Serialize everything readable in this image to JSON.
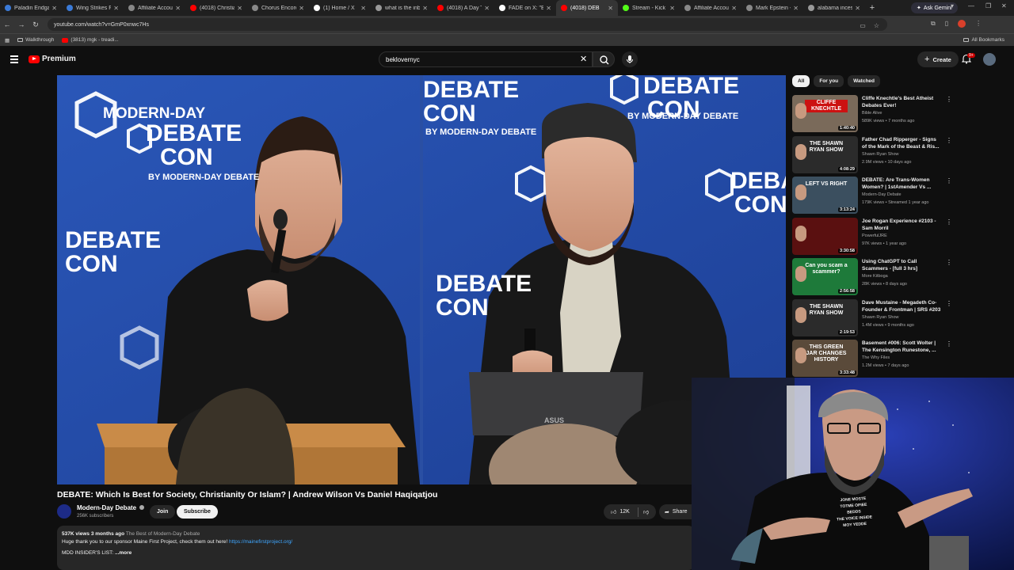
{
  "browser": {
    "tabs": [
      {
        "title": "Paladin Endgan",
        "color": "#3b7bd8"
      },
      {
        "title": "Wing Strikes Fa",
        "color": "#3b7bd8"
      },
      {
        "title": "Affiliate Accoun",
        "color": "#888888"
      },
      {
        "title": "(4018) Christian",
        "color": "#ff0000"
      },
      {
        "title": "Chorus Encore",
        "color": "#888888"
      },
      {
        "title": "(1) Home / X",
        "color": "#ffffff"
      },
      {
        "title": "what is the inbo",
        "color": "#999999"
      },
      {
        "title": "(4018) A Day Tr",
        "color": "#ff0000"
      },
      {
        "title": "FADE on X: \"Bui",
        "color": "#ffffff"
      },
      {
        "title": "(4018) DEB",
        "color": "#ff0000",
        "active": true
      },
      {
        "title": "Stream - Kick D",
        "color": "#53fc18"
      },
      {
        "title": "Affiliate Accoun",
        "color": "#888888"
      },
      {
        "title": "Mark Epstein -",
        "color": "#888888"
      },
      {
        "title": "alabama incest",
        "color": "#999999"
      }
    ],
    "new_tab": "+",
    "ask_gemini": "Ask Gemini",
    "url": "youtube.com/watch?v=GmP0xnwc7Hs",
    "bookmarks": [
      {
        "label": "Walkthrough",
        "type": "folder"
      },
      {
        "label": "(3813) mgk - treadi...",
        "type": "youtube"
      }
    ],
    "all_bookmarks": "All Bookmarks"
  },
  "header": {
    "logo_text": "Premium",
    "search_value": "beklovernyc",
    "create_label": "Create",
    "notification_count": "9+"
  },
  "video": {
    "overlay_texts": {
      "brand_line1": "MODERN-DAY",
      "brand_line2": "DEBATE",
      "debate": "DEBATE",
      "con": "CON",
      "by": "BY MODERN-DAY DEBATE",
      "asus": "ASUS"
    },
    "title": "DEBATE: Which Is Best for Society, Christianity Or Islam? | Andrew Wilson Vs Daniel Haqiqatjou",
    "channel": {
      "name": "Modern-Day Debate",
      "subscribers": "256K subscribers",
      "join_label": "Join",
      "subscribe_label": "Subscribe"
    },
    "likes": "12K",
    "share_label": "Share",
    "description": {
      "meta": "537K views  3 months ago",
      "hashtags": "The Best of Modern-Day Debate",
      "line2_text": "Huge thank you to our sponsor Maine First Project, check them out here!",
      "line2_link": "https://mainefirstproject.org/",
      "line3": "MDD INSIDER'S LIST:",
      "more": "...more"
    }
  },
  "sidebar": {
    "chips": [
      {
        "label": "All",
        "selected": true
      },
      {
        "label": "For you",
        "selected": false
      },
      {
        "label": "Watched",
        "selected": false
      }
    ],
    "recommendations": [
      {
        "title": "Cliffe Knechtle's Best Atheist Debates Ever!",
        "channel": "Bible Alive",
        "meta": "589K views • 7 months ago",
        "duration": "1:40:40",
        "thumb_bg": "#7a6a5a",
        "thumb_text": "CLIFFE KNECHTLE",
        "thumb_text_color": "#ffffff",
        "thumb_text_bg": "#cc1111"
      },
      {
        "title": "Father Chad Ripperger - Signs of the Mark of the Beast & Ris...",
        "channel": "Shawn Ryan Show",
        "meta": "2.9M views • 10 days ago",
        "duration": "4:08:29",
        "thumb_bg": "#2b2b2b",
        "thumb_text": "THE SHAWN RYAN SHOW",
        "thumb_text_color": "#ffffff",
        "thumb_text_bg": "#2b2b2b"
      },
      {
        "title": "DEBATE: Are Trans-Women Women? | 1stAmender Vs ...",
        "channel": "Modern-Day Debate",
        "meta": "179K views • Streamed 1 year ago",
        "duration": "3:13:24",
        "thumb_bg": "#3b4f5f",
        "thumb_text": "LEFT VS RIGHT",
        "thumb_text_color": "#ffffff",
        "thumb_text_bg": "#3b4f5f"
      },
      {
        "title": "Joe Rogan Experience #2103 - Sam Morril",
        "channel": "PowerfulJRE",
        "meta": "97K views • 1 year ago",
        "duration": "3:30:58",
        "thumb_bg": "#5a1010",
        "thumb_text": "",
        "thumb_text_color": "#ffffff",
        "thumb_text_bg": "#5a1010"
      },
      {
        "title": "Using ChatGPT to Call Scammers - [full 3 hrs]",
        "channel": "More Kitboga",
        "meta": "28K views • 8 days ago",
        "duration": "2:56:58",
        "thumb_bg": "#1e7a3a",
        "thumb_text": "Can you scam a scammer?",
        "thumb_text_color": "#ffffff",
        "thumb_text_bg": "#1e7a3a"
      },
      {
        "title": "Dave Mustaine - Megadeth Co-Founder & Frontman | SRS #203",
        "channel": "Shawn Ryan Show",
        "meta": "1.4M views • 9 months ago",
        "duration": "2:19:53",
        "thumb_bg": "#2b2b2b",
        "thumb_text": "THE SHAWN RYAN SHOW",
        "thumb_text_color": "#ffffff",
        "thumb_text_bg": "#2b2b2b"
      },
      {
        "title": "Basement #006: Scott Wolter | The Kensington Runestone, ...",
        "channel": "The Why Files",
        "meta": "1.2M views • 7 days ago",
        "duration": "3:33:48",
        "thumb_bg": "#5a4a3a",
        "thumb_text": "THIS GREEN JAR CHANGES HISTORY",
        "thumb_text_color": "#ffffff",
        "thumb_text_bg": "#5a4a3a"
      }
    ]
  },
  "webcam": {
    "shirt_lines": [
      "JONE MOSTE",
      "TOTME OPIEE",
      "BEDDS",
      "THE VOICE INSIDE",
      "MOY YEDDE"
    ]
  }
}
